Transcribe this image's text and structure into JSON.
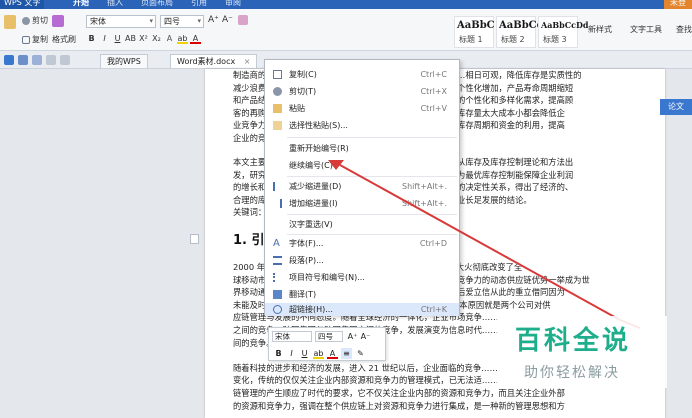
{
  "titlebar": {
    "app": "WPS 文字",
    "tabs": [
      "开始",
      "插入",
      "页面布局",
      "引用",
      "审阅"
    ],
    "right": "未登"
  },
  "ribbon": {
    "cut": "剪切",
    "copy": "复制",
    "format_painter": "格式刷",
    "font": "宋体",
    "size": "四号",
    "styles": [
      {
        "sample": "AaBbC",
        "name": "标题 1"
      },
      {
        "sample": "AaBbCc",
        "name": "标题 2"
      },
      {
        "sample": "AaBbCcDd",
        "name": "标题 3"
      }
    ],
    "new_style": "新样式",
    "text_tools": "文字工具",
    "find": "查找"
  },
  "quickbar": {
    "tab_mywps": "我的WPS",
    "tab_doc": "Word素材.docx"
  },
  "document": {
    "lines_top": [
      "制造商的………………………………………………………………相日可观，降低库存是实质性的",
      "减少浪费……………………………………………………………个性化增加，产品寿命周期缩短",
      "和产品结……………………………………………………………的个性化和多样化需求，提高顾",
      "客的再购……………………………………………………………库存量太大成本小都会降低企",
      "业竞争力……………………………………………………………库存周期和资金的利用，提高",
      "企业的竞……"
    ],
    "lines_mid": [
      "本文主要……………………………………………………………从库存及库存控制理论和方法出",
      "发，研究……………………………………………………………为最优库存控制能保障企业利润",
      "的增长和……………………………………………………………的决定性关系，得出了经济的、",
      "合理的库……………………………………………………………业长足发展的结论。",
      "关键词：……"
    ],
    "heading": "1. 引言",
    "lines_bottom": [
      "2000 年美……………………美国得克萨斯州芯片工厂的一场大火彻底改变了全",
      "球移动市……………………………………………业凭借其极具竞争力的动态供应链优势一举成为世",
      "界移动通信产品的霸主，并将竞争优势一直保持到今天，而此后爱立信从此的重立借同因为",
      "未能及时调整供应渠道而从此一蹶不振。'造成这场竞赛迁的根本原因就是两个公司对供",
      "应链管理与发展的不同态度。随着全球经济的一体化，企业市场竞争……",
      "之间的竞争、跨国集团与跨国集团之间的竞争，发展演变为信息时代……",
      "间的竞争。",
      "",
      "随着科技的进步和经济的发展，进入 21 世纪以后，企业面临的竞争……",
      "变化，传统的仅仅关注企业内部资源和竞争力的管理模式，已无法适……",
      "链管理的产生顺应了时代的要求，它不仅关注企业内部的资源和竞争力，而且关注企业外部",
      "的资源和竞争力，强调在整个供应链上对资源和竞争力进行集成，是一种新的管理思想和方"
    ],
    "side_tag": "论文"
  },
  "context_menu": {
    "items": [
      {
        "label": "复制(C)",
        "shortcut": "Ctrl+C"
      },
      {
        "label": "剪切(T)",
        "shortcut": "Ctrl+X"
      },
      {
        "label": "粘贴",
        "shortcut": "Ctrl+V"
      },
      {
        "label": "选择性粘贴(S)...",
        "shortcut": ""
      },
      {
        "label": "重新开始编号(R)",
        "shortcut": ""
      },
      {
        "label": "继续编号(C)",
        "shortcut": ""
      },
      {
        "label": "减少缩进量(D)",
        "shortcut": "Shift+Alt+."
      },
      {
        "label": "增加缩进量(I)",
        "shortcut": "Shift+Alt+."
      },
      {
        "label": "汉字重选(V)",
        "shortcut": ""
      },
      {
        "label": "字体(F)...",
        "shortcut": "Ctrl+D"
      },
      {
        "label": "段落(P)...",
        "shortcut": ""
      },
      {
        "label": "项目符号和编号(N)...",
        "shortcut": ""
      },
      {
        "label": "翻译(T)",
        "shortcut": ""
      },
      {
        "label": "超链接(H)...",
        "shortcut": "Ctrl+K"
      }
    ]
  },
  "mini_toolbar": {
    "font": "宋体",
    "size": "四号"
  },
  "watermark": {
    "logo": "百科全说",
    "sub": "助你轻松解决"
  },
  "colors": {
    "title_blue": "#2a63b8",
    "highlight": "#dbe8fb",
    "arrow": "#d83a3a",
    "watermark": "#1fae8c"
  }
}
